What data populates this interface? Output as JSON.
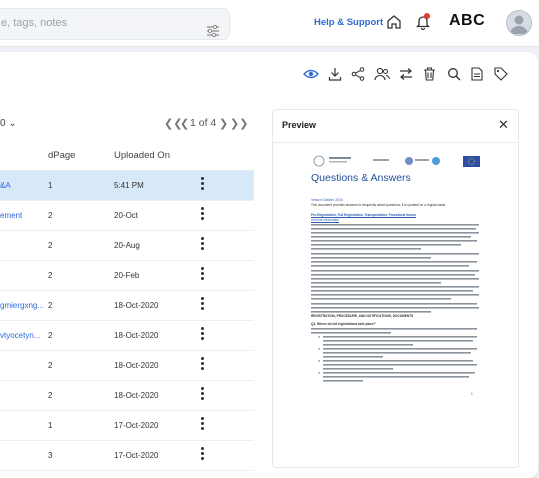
{
  "search": {
    "placeholder": "e, tags, notes"
  },
  "header": {
    "help": "Help & Support",
    "brand": "ABC"
  },
  "pagination": {
    "label": "1 of 4"
  },
  "table": {
    "columns": [
      "dPage",
      "Uploaded On"
    ],
    "rows": [
      {
        "name": "&A",
        "page": "1",
        "uploaded": "5:41 PM",
        "selected": true
      },
      {
        "name": "ement",
        "page": "2",
        "uploaded": "20-Oct",
        "selected": false
      },
      {
        "name": "",
        "page": "2",
        "uploaded": "20-Aug",
        "selected": false
      },
      {
        "name": "",
        "page": "2",
        "uploaded": "20-Feb",
        "selected": false
      },
      {
        "name": "gmiergxng...",
        "page": "2",
        "uploaded": "18-Oct-2020",
        "selected": false
      },
      {
        "name": "vtyocetyn...",
        "page": "2",
        "uploaded": "18-Oct-2020",
        "selected": false
      },
      {
        "name": "",
        "page": "2",
        "uploaded": "18-Oct-2020",
        "selected": false
      },
      {
        "name": "",
        "page": "2",
        "uploaded": "18-Oct-2020",
        "selected": false
      },
      {
        "name": "",
        "page": "1",
        "uploaded": "17-Oct-2020",
        "selected": false
      },
      {
        "name": "",
        "page": "3",
        "uploaded": "17-Oct-2020",
        "selected": false
      }
    ]
  },
  "preview": {
    "title": "Preview",
    "doc": {
      "title": "Questions & Answers",
      "version": "Version October, 2016",
      "intro": "This document provides answers to frequently asked questions; it is updated on a regular basis.",
      "section1": "Pre-Registration, Full Registration, Transportation, Procedural Issues",
      "section1b": "General information",
      "section2": "REGISTRATION, PROCEDURE, AND NOTIFICATIONS, DOCUMENTS",
      "q1": "Q1. Where do full registrations take place?",
      "page_number": "1"
    }
  },
  "colors": {
    "accent": "#2d6bd6",
    "selected_row": "#d7e9f8",
    "doc_title": "#1e4f9a"
  }
}
